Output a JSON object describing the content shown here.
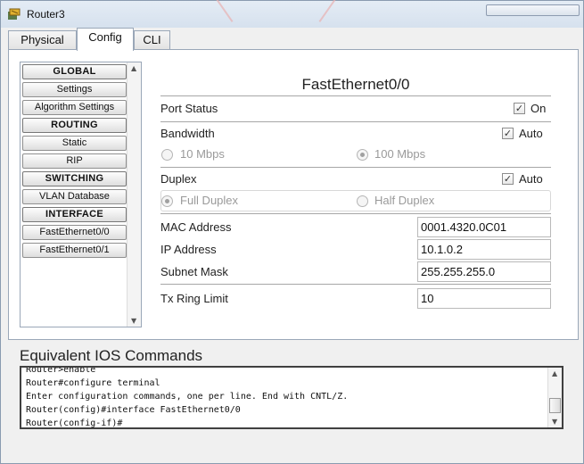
{
  "window": {
    "title": "Router3"
  },
  "tabs": [
    {
      "label": "Physical"
    },
    {
      "label": "Config"
    },
    {
      "label": "CLI"
    }
  ],
  "active_tab": "Config",
  "sidebar": {
    "items": [
      {
        "label": "GLOBAL",
        "header": true
      },
      {
        "label": "Settings",
        "header": false
      },
      {
        "label": "Algorithm Settings",
        "header": false
      },
      {
        "label": "ROUTING",
        "header": true
      },
      {
        "label": "Static",
        "header": false
      },
      {
        "label": "RIP",
        "header": false
      },
      {
        "label": "SWITCHING",
        "header": true
      },
      {
        "label": "VLAN Database",
        "header": false
      },
      {
        "label": "INTERFACE",
        "header": true
      },
      {
        "label": "FastEthernet0/0",
        "header": false
      },
      {
        "label": "FastEthernet0/1",
        "header": false
      }
    ]
  },
  "interface": {
    "title": "FastEthernet0/0",
    "port_status": {
      "label": "Port Status",
      "checkbox_label": "On",
      "checked": true
    },
    "bandwidth": {
      "label": "Bandwidth",
      "auto_label": "Auto",
      "auto_checked": true,
      "options": [
        {
          "label": "10 Mbps",
          "selected": false
        },
        {
          "label": "100 Mbps",
          "selected": true
        }
      ]
    },
    "duplex": {
      "label": "Duplex",
      "auto_label": "Auto",
      "auto_checked": true,
      "options": [
        {
          "label": "Full Duplex",
          "selected": true
        },
        {
          "label": "Half Duplex",
          "selected": false
        }
      ]
    },
    "mac_address": {
      "label": "MAC Address",
      "value": "0001.4320.0C01"
    },
    "ip_address": {
      "label": "IP Address",
      "value": "10.1.0.2"
    },
    "subnet_mask": {
      "label": "Subnet Mask",
      "value": "255.255.255.0"
    },
    "tx_ring_limit": {
      "label": "Tx Ring Limit",
      "value": "10"
    }
  },
  "ios": {
    "title": "Equivalent IOS Commands",
    "lines": [
      "Router>enable",
      "Router#configure terminal",
      "Enter configuration commands, one per line.  End with CNTL/Z.",
      "Router(config)#interface FastEthernet0/0",
      "Router(config-if)#"
    ]
  }
}
